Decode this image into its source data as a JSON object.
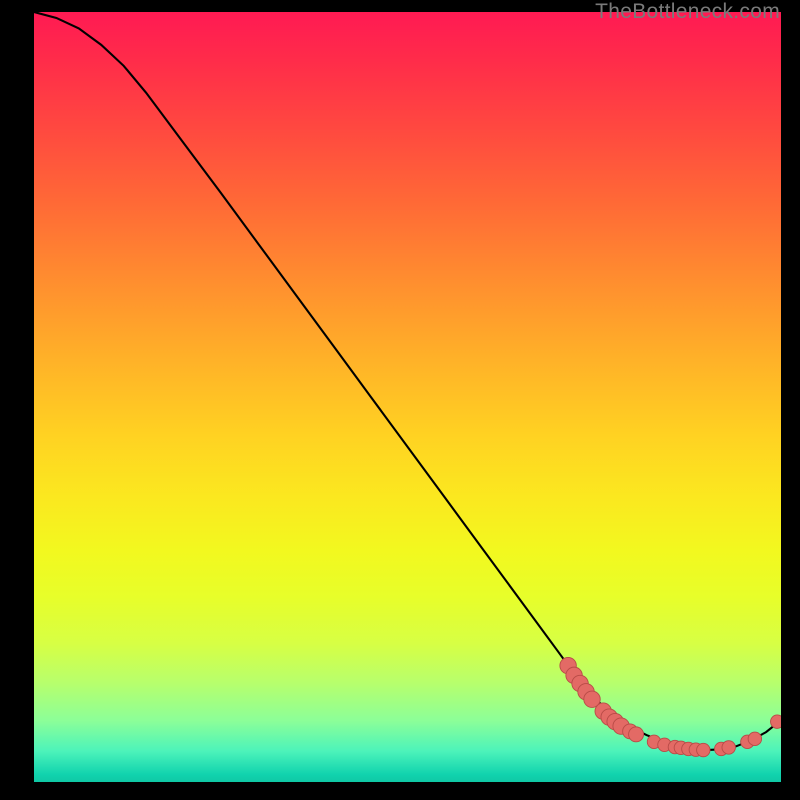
{
  "watermark": "TheBottleneck.com",
  "colors": {
    "curve": "#000000",
    "marker_fill": "#e36a65",
    "marker_stroke": "#b84b47"
  },
  "chart_data": {
    "type": "line",
    "title": "",
    "xlabel": "",
    "ylabel": "",
    "xlim": [
      0,
      100
    ],
    "ylim": [
      0,
      100
    ],
    "grid": false,
    "legend": false,
    "series": [
      {
        "name": "curve",
        "x": [
          0,
          3,
          6,
          9,
          12,
          15,
          20,
          25,
          30,
          35,
          40,
          45,
          50,
          55,
          60,
          65,
          70,
          73,
          76,
          78,
          80,
          82,
          84,
          86,
          88,
          90,
          92,
          94,
          96,
          98,
          100
        ],
        "y": [
          100,
          99.2,
          97.8,
          95.6,
          92.8,
          89.2,
          82.5,
          75.8,
          69.0,
          62.2,
          55.4,
          48.6,
          41.8,
          35.0,
          28.2,
          21.4,
          14.6,
          10.5,
          7.2,
          5.5,
          4.2,
          3.2,
          2.4,
          1.8,
          1.4,
          1.2,
          1.3,
          1.7,
          2.5,
          3.6,
          5.2
        ]
      }
    ],
    "markers": [
      {
        "x": 71.5,
        "y": 12.5,
        "r": 1.1
      },
      {
        "x": 72.3,
        "y": 11.2,
        "r": 1.1
      },
      {
        "x": 73.1,
        "y": 10.1,
        "r": 1.1
      },
      {
        "x": 73.9,
        "y": 9.0,
        "r": 1.1
      },
      {
        "x": 74.7,
        "y": 8.0,
        "r": 1.1
      },
      {
        "x": 76.2,
        "y": 6.4,
        "r": 1.1
      },
      {
        "x": 77.0,
        "y": 5.6,
        "r": 1.1
      },
      {
        "x": 77.8,
        "y": 5.0,
        "r": 1.1
      },
      {
        "x": 78.6,
        "y": 4.4,
        "r": 1.1
      },
      {
        "x": 79.8,
        "y": 3.7,
        "r": 1.0
      },
      {
        "x": 80.6,
        "y": 3.3,
        "r": 1.0
      },
      {
        "x": 83.0,
        "y": 2.3,
        "r": 0.9
      },
      {
        "x": 84.4,
        "y": 1.9,
        "r": 0.9
      },
      {
        "x": 85.8,
        "y": 1.6,
        "r": 0.9
      },
      {
        "x": 86.6,
        "y": 1.5,
        "r": 0.9
      },
      {
        "x": 87.6,
        "y": 1.35,
        "r": 0.9
      },
      {
        "x": 88.6,
        "y": 1.25,
        "r": 0.9
      },
      {
        "x": 89.6,
        "y": 1.2,
        "r": 0.9
      },
      {
        "x": 92.0,
        "y": 1.35,
        "r": 0.9
      },
      {
        "x": 93.0,
        "y": 1.55,
        "r": 0.9
      },
      {
        "x": 95.5,
        "y": 2.3,
        "r": 0.9
      },
      {
        "x": 96.5,
        "y": 2.7,
        "r": 0.9
      },
      {
        "x": 99.5,
        "y": 5.0,
        "r": 0.9
      }
    ]
  }
}
